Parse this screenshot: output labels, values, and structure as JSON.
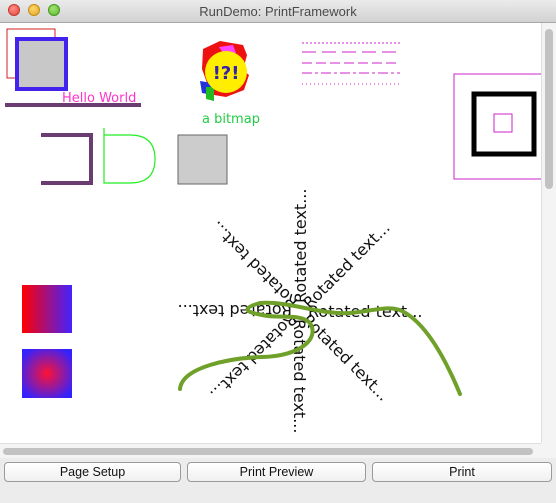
{
  "window": {
    "title": "RunDemo: PrintFramework"
  },
  "canvas": {
    "hello_text": "Hello World",
    "bitmap_glyph": "!?!",
    "bitmap_caption": "a bitmap",
    "rotated_label": "Rotated text..."
  },
  "buttons": {
    "page_setup": "Page Setup",
    "print_preview": "Print Preview",
    "print": "Print"
  },
  "colors": {
    "magenta": "#ff33cc",
    "purple": "#6a3c72",
    "blue": "#3333ee",
    "green_stroke": "#6fa02a",
    "bright_green": "#22cc22"
  }
}
